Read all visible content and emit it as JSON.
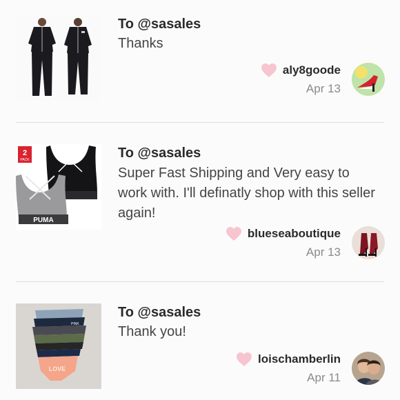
{
  "reviews": [
    {
      "to": "To @sasales",
      "message": "Thanks",
      "username": "aly8goode",
      "date": "Apr 13",
      "thumbnail_icon": "black-pajama-set-image",
      "avatar_icon": "shoe-avatar"
    },
    {
      "to": "To @sasales",
      "message": "Super Fast Shipping and Very easy to work with. I'll definatly shop with this seller again!",
      "username": "blueseaboutique",
      "date": "Apr 13",
      "thumbnail_icon": "sports-bra-image",
      "thumbnail_badge": "2",
      "thumbnail_badge_sub": "PACK",
      "thumbnail_brand": "PUMA",
      "avatar_icon": "heels-avatar"
    },
    {
      "to": "To @sasales",
      "message": "Thank you!",
      "username": "loischamberlin",
      "date": "Apr 11",
      "thumbnail_icon": "underwear-stack-image",
      "avatar_icon": "couple-avatar"
    }
  ],
  "colors": {
    "heart": "#f7c5cf",
    "divider": "#dcdcdc",
    "date": "#8a8a8a"
  }
}
